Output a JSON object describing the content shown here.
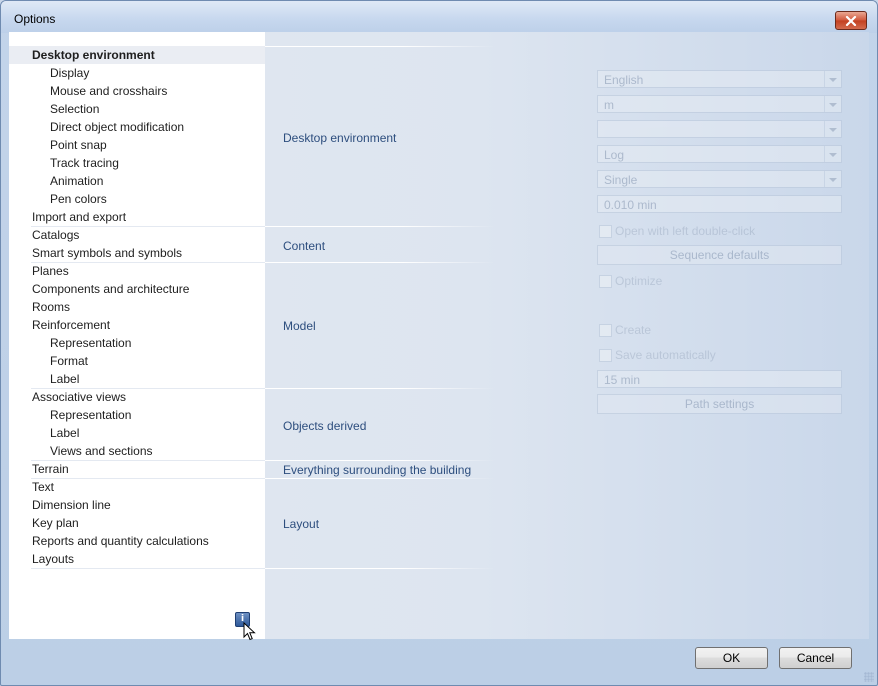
{
  "window": {
    "title": "Options"
  },
  "tree": {
    "items": [
      {
        "label": "Desktop environment",
        "level": 0,
        "selected": true
      },
      {
        "label": "Display",
        "level": 1
      },
      {
        "label": "Mouse and crosshairs",
        "level": 1
      },
      {
        "label": "Selection",
        "level": 1
      },
      {
        "label": "Direct object modification",
        "level": 1
      },
      {
        "label": "Point snap",
        "level": 1
      },
      {
        "label": "Track tracing",
        "level": 1
      },
      {
        "label": "Animation",
        "level": 1
      },
      {
        "label": "Pen colors",
        "level": 1
      },
      {
        "label": "Import and export",
        "level": 0
      },
      {
        "label": "Catalogs",
        "level": 0
      },
      {
        "label": "Smart symbols and symbols",
        "level": 0
      },
      {
        "label": "Planes",
        "level": 0
      },
      {
        "label": "Components and architecture",
        "level": 0
      },
      {
        "label": "Rooms",
        "level": 0
      },
      {
        "label": "Reinforcement",
        "level": 0
      },
      {
        "label": "Representation",
        "level": 1
      },
      {
        "label": "Format",
        "level": 1
      },
      {
        "label": "Label",
        "level": 1
      },
      {
        "label": "Associative views",
        "level": 0
      },
      {
        "label": "Representation",
        "level": 1
      },
      {
        "label": "Label",
        "level": 1
      },
      {
        "label": "Views and sections",
        "level": 1
      },
      {
        "label": "Terrain",
        "level": 0
      },
      {
        "label": "Text",
        "level": 0
      },
      {
        "label": "Dimension line",
        "level": 0
      },
      {
        "label": "Key plan",
        "level": 0
      },
      {
        "label": "Reports and quantity calculations",
        "level": 0
      },
      {
        "label": "Layouts",
        "level": 0
      }
    ],
    "info_icon": "info-icon"
  },
  "sections": [
    {
      "label": "Desktop environment"
    },
    {
      "label": "Content"
    },
    {
      "label": "Model"
    },
    {
      "label": "Objects derived"
    },
    {
      "label": "Everything surrounding the building"
    },
    {
      "label": "Layout"
    }
  ],
  "ghost": {
    "language": "English",
    "unit": "m",
    "display_mode": "Log",
    "window_mode": "Single",
    "time_value": "0.010 min",
    "open_double_click": "Open with left double-click",
    "sequence_defaults": "Sequence defaults",
    "optimize": "Optimize",
    "create": "Create",
    "save_automatically": "Save automatically",
    "save_interval": "15 min",
    "path_settings": "Path settings"
  },
  "buttons": {
    "ok": "OK",
    "cancel": "Cancel"
  },
  "colors": {
    "section_text": "#2d4e7e",
    "window_frame": "#c3d4ea",
    "close_button": "#c2401f"
  }
}
